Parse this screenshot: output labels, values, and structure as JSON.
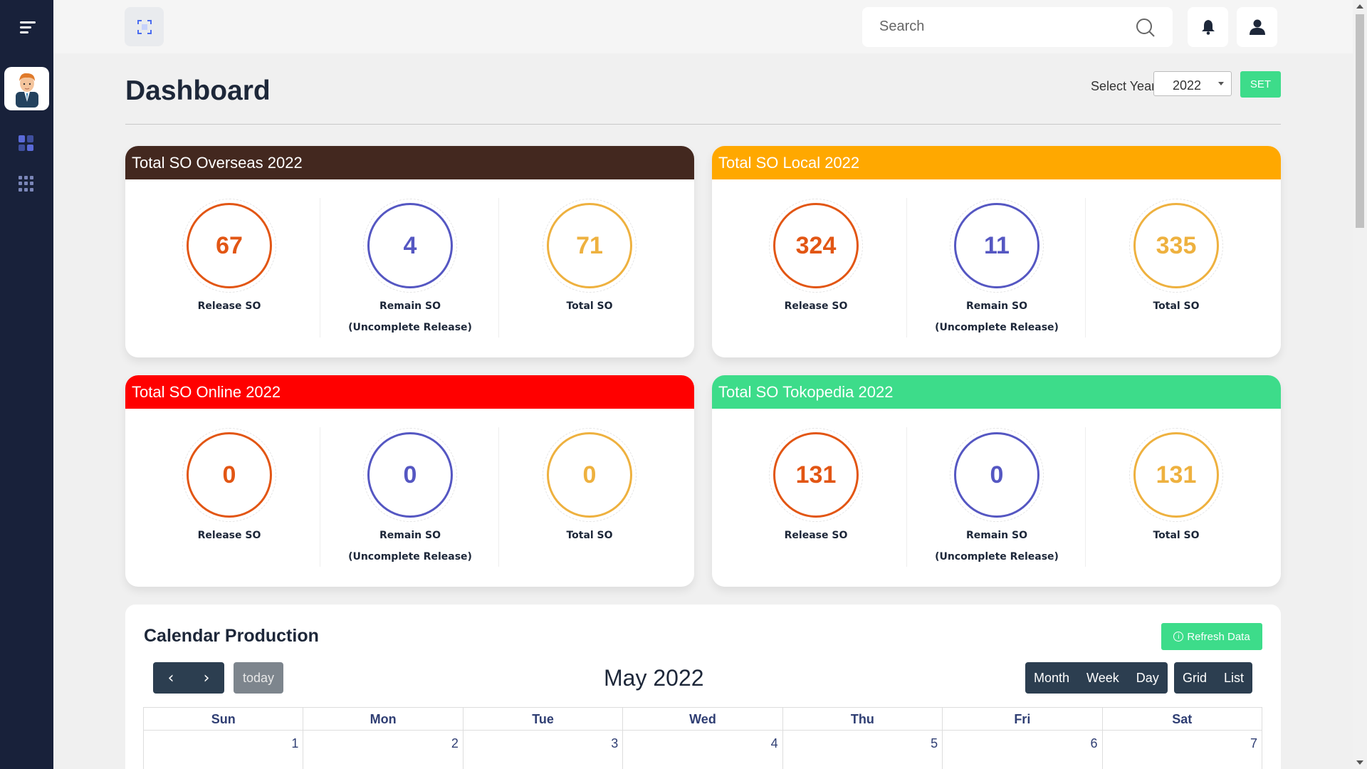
{
  "topbar": {
    "search_placeholder": "Search"
  },
  "header": {
    "title": "Dashboard",
    "year_label": "Select Year",
    "year_value": "2022",
    "set_label": "SET"
  },
  "cards": [
    {
      "title": "Total SO Overseas 2022",
      "color": "#43281f",
      "release": "67",
      "remain": "4",
      "total": "71"
    },
    {
      "title": "Total SO Local 2022",
      "color": "#ffa800",
      "release": "324",
      "remain": "11",
      "total": "335"
    },
    {
      "title": "Total SO Online 2022",
      "color": "#ff0000",
      "release": "0",
      "remain": "0",
      "total": "0"
    },
    {
      "title": "Total SO Tokopedia 2022",
      "color": "#3ddc8a",
      "release": "131",
      "remain": "0",
      "total": "131"
    }
  ],
  "stat_labels": {
    "release": "Release SO",
    "remain": "Remain SO",
    "remain_sub": "(Uncomplete Release)",
    "total": "Total SO"
  },
  "calendar": {
    "title": "Calendar Production",
    "refresh_label": "Refresh Data",
    "today_label": "today",
    "month_title": "May 2022",
    "views": [
      "Month",
      "Week",
      "Day"
    ],
    "view_modes": [
      "Grid",
      "List"
    ],
    "weekdays": [
      "Sun",
      "Mon",
      "Tue",
      "Wed",
      "Thu",
      "Fri",
      "Sat"
    ],
    "first_week": [
      "1",
      "2",
      "3",
      "4",
      "5",
      "6",
      "7"
    ]
  },
  "colors": {
    "sidebar": "#18213a",
    "accent_green": "#3ddc8a",
    "ring_orange": "#e25614",
    "ring_blue": "#5557c2",
    "ring_gold": "#eeb13f"
  }
}
